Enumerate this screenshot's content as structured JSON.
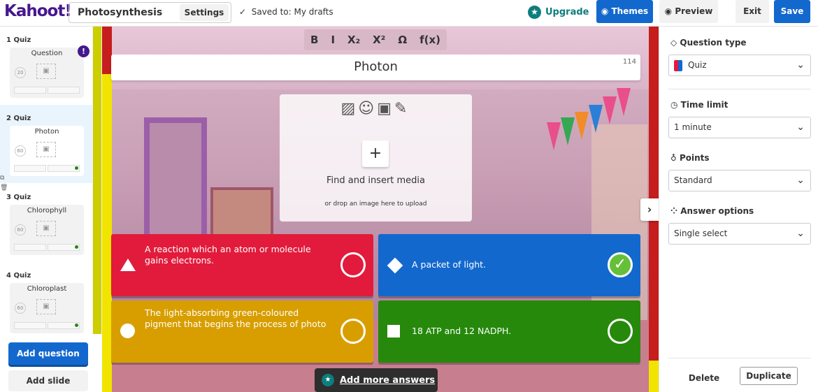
{
  "app": {
    "logo": "Kahoot!",
    "brand_color": "#46178f",
    "accent_blue": "#1368ce"
  },
  "header": {
    "title": "Photosynthesis",
    "settings_label": "Settings",
    "saved_status": "Saved to: My drafts",
    "upgrade_label": "Upgrade",
    "themes_label": "Themes",
    "preview_label": "Preview",
    "exit_label": "Exit",
    "save_label": "Save"
  },
  "sidebar": {
    "slides": [
      {
        "label": "1 Quiz",
        "title": "Question",
        "time": "20",
        "has_alert": true
      },
      {
        "label": "2 Quiz",
        "title": "Photon",
        "time": "60",
        "active": true
      },
      {
        "label": "3 Quiz",
        "title": "Chlorophyll",
        "time": "60"
      },
      {
        "label": "4 Quiz",
        "title": "Chloroplast",
        "time": "60"
      }
    ],
    "add_question_label": "Add question",
    "add_slide_label": "Add slide"
  },
  "editor": {
    "toolbar": [
      "B",
      "I",
      "X₂",
      "X²",
      "Ω",
      "f(x)"
    ],
    "question": "Photon",
    "char_count": "114",
    "media_title": "Find and insert media",
    "media_sub": "or drop an image here to upload",
    "answers": [
      {
        "text": "A reaction which an atom or molecule gains electrons.",
        "color": "#e21b3c",
        "shape": "triangle",
        "correct": false
      },
      {
        "text": "A packet of light.",
        "color": "#1368ce",
        "shape": "diamond",
        "correct": true
      },
      {
        "text": "The light-absorbing green-coloured pigment that begins the process of photo",
        "color": "#d89e00",
        "shape": "circle",
        "correct": false
      },
      {
        "text": "18 ATP and 12 NADPH.",
        "color": "#26890c",
        "shape": "square",
        "correct": false
      }
    ],
    "add_more_label": "Add more answers"
  },
  "right_panel": {
    "question_type_title": "Question type",
    "question_type_value": "Quiz",
    "time_limit_title": "Time limit",
    "time_limit_value": "1 minute",
    "points_title": "Points",
    "points_value": "Standard",
    "answer_options_title": "Answer options",
    "answer_options_value": "Single select",
    "delete_label": "Delete",
    "duplicate_label": "Duplicate"
  }
}
